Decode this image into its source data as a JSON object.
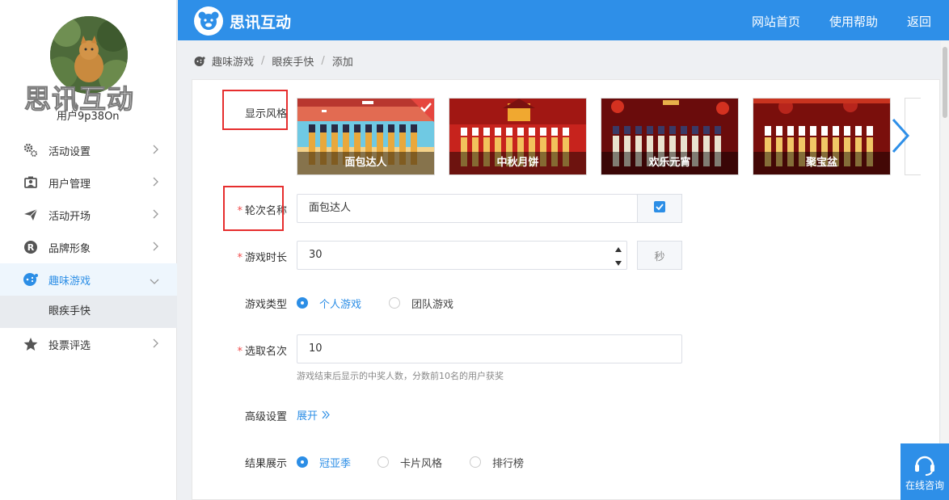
{
  "sidebar": {
    "logo_text": "思讯互动",
    "username": "用户9p38On",
    "items": [
      {
        "label": "活动设置",
        "icon": "gears-icon"
      },
      {
        "label": "用户管理",
        "icon": "user-card-icon"
      },
      {
        "label": "活动开场",
        "icon": "paper-plane-icon"
      },
      {
        "label": "品牌形象",
        "icon": "registered-icon"
      },
      {
        "label": "趣味游戏",
        "icon": "game-icon"
      },
      {
        "label": "投票评选",
        "icon": "star-icon"
      }
    ],
    "submenu": {
      "label": "眼疾手快"
    }
  },
  "header": {
    "brand": "思讯互动",
    "nav": [
      "网站首页",
      "使用帮助",
      "返回"
    ]
  },
  "breadcrumb": {
    "items": [
      "趣味游戏",
      "眼疾手快",
      "添加"
    ]
  },
  "form": {
    "style_label": "显示风格",
    "themes": [
      {
        "name": "面包达人",
        "selected": true
      },
      {
        "name": "中秋月饼",
        "selected": false
      },
      {
        "name": "欢乐元宵",
        "selected": false
      },
      {
        "name": "聚宝盆",
        "selected": false
      }
    ],
    "round_name": {
      "label": "轮次名称",
      "value": "面包达人"
    },
    "duration": {
      "label": "游戏时长",
      "value": "30",
      "unit": "秒"
    },
    "game_type": {
      "label": "游戏类型",
      "options": [
        "个人游戏",
        "团队游戏"
      ],
      "selected": "个人游戏"
    },
    "winners": {
      "label": "选取名次",
      "value": "10",
      "help": "游戏结束后显示的中奖人数，分数前10名的用户获奖"
    },
    "advanced": {
      "label": "高级设置",
      "toggle": "展开"
    },
    "result_display": {
      "label": "结果展示",
      "options": [
        "冠亚季",
        "卡片风格",
        "排行榜"
      ],
      "selected": "冠亚季"
    }
  },
  "consult": {
    "label": "在线咨询"
  },
  "colors": {
    "primary": "#2e8fe8",
    "required": "#f04b4b",
    "highlight_box": "#e62e2e"
  }
}
